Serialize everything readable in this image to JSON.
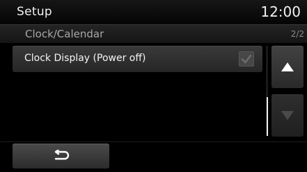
{
  "header": {
    "title": "Setup",
    "clock": "12:00"
  },
  "subheader": {
    "title": "Clock/Calendar",
    "page": "2/2"
  },
  "list": {
    "items": [
      {
        "label": "Clock Display (Power off)",
        "checked": true
      }
    ]
  },
  "scroll": {
    "up_icon": "up-triangle-icon",
    "down_icon": "down-triangle-icon",
    "down_enabled": false
  },
  "footer": {
    "back_icon": "return-arrow-icon"
  },
  "colors": {
    "background": "#000000",
    "row": "#333333",
    "text": "#ffffff",
    "muted_text": "#a8a8a8",
    "disabled_icon": "#4a4a4a"
  }
}
